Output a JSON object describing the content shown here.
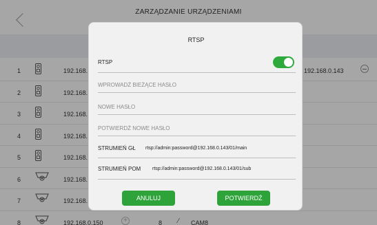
{
  "header": {
    "title": "ZARZĄDZANIE URZĄDZENIAMI",
    "back_icon": "chevron-left-icon"
  },
  "rows": [
    {
      "num": "1",
      "icon": "doorbell-icon",
      "ip": "192.168.",
      "ip_right": "192.168.0.143"
    },
    {
      "num": "2",
      "icon": "doorbell-icon",
      "ip": "192.168."
    },
    {
      "num": "3",
      "icon": "doorbell-icon",
      "ip": "192.168."
    },
    {
      "num": "4",
      "icon": "doorbell-icon",
      "ip": "192.168."
    },
    {
      "num": "5",
      "icon": "doorbell-icon",
      "ip": "192.168."
    },
    {
      "num": "6",
      "icon": "camera-icon",
      "ip": "192.168."
    },
    {
      "num": "7",
      "icon": "camera-icon",
      "ip": "192.168."
    },
    {
      "num": "8",
      "icon": "camera-icon",
      "ip": "192.168.0.150",
      "channel": "8",
      "name": "CAM8"
    }
  ],
  "modal": {
    "title": "RTSP",
    "rtsp_label": "RTSP",
    "rtsp_enabled": true,
    "current_password_placeholder": "WPROWADŹ BIEŻĄCE HASŁO",
    "new_password_placeholder": "NOWE HASŁO",
    "confirm_password_placeholder": "POTWIERDŹ NOWE HASŁO",
    "main_stream_label": "STRUMIEŃ GŁ",
    "main_stream_value": "rtsp://admin:password@192.168.0.143/01/main",
    "sub_stream_label": "STRUMIEŃ POM",
    "sub_stream_value": "rtsp://admin:password@192.168.0.143/01/sub",
    "cancel_label": "ANULUJ",
    "confirm_label": "POTWIERDŹ"
  },
  "colors": {
    "accent_green": "#2eaa3c",
    "overlay": "rgba(0,0,0,0.35)"
  }
}
